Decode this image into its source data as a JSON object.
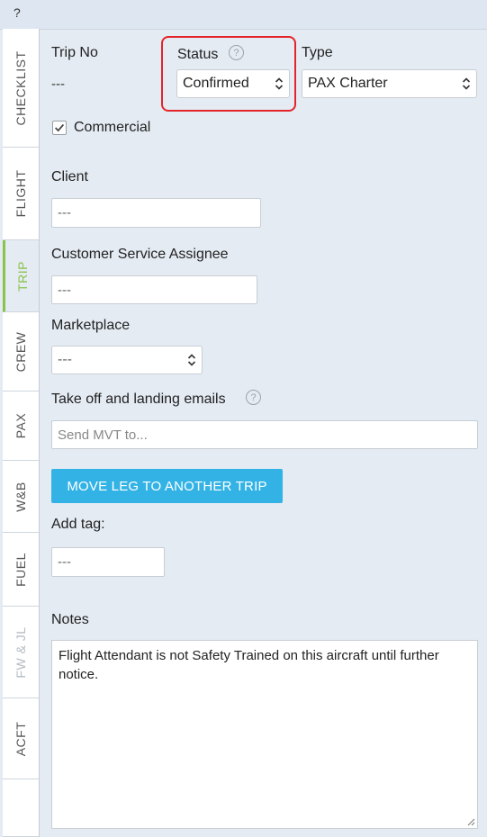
{
  "topbar": {
    "help": "?"
  },
  "side_tabs": [
    {
      "label": "CHECKLIST",
      "state": "normal"
    },
    {
      "label": "FLIGHT",
      "state": "normal"
    },
    {
      "label": "TRIP",
      "state": "active"
    },
    {
      "label": "CREW",
      "state": "normal"
    },
    {
      "label": "PAX",
      "state": "normal"
    },
    {
      "label": "W&B",
      "state": "normal"
    },
    {
      "label": "FUEL",
      "state": "normal"
    },
    {
      "label": "FW & JL",
      "state": "disabled"
    },
    {
      "label": "ACFT",
      "state": "normal"
    }
  ],
  "trip_no": {
    "label": "Trip No",
    "value": "---"
  },
  "status": {
    "label": "Status",
    "value": "Confirmed",
    "help": "?"
  },
  "type": {
    "label": "Type",
    "value": "PAX Charter"
  },
  "commercial": {
    "label": "Commercial",
    "checked": true
  },
  "client": {
    "label": "Client",
    "value": "---"
  },
  "cs_assignee": {
    "label": "Customer Service Assignee",
    "value": "---"
  },
  "marketplace": {
    "label": "Marketplace",
    "value": "---"
  },
  "emails": {
    "label": "Take off and landing emails",
    "placeholder": "Send MVT to...",
    "help": "?"
  },
  "move_button": {
    "label": "MOVE LEG TO ANOTHER TRIP"
  },
  "add_tag": {
    "label": "Add tag:",
    "value": "---"
  },
  "notes": {
    "label": "Notes",
    "value": "Flight Attendant is not Safety Trained on this aircraft until further notice."
  },
  "colors": {
    "accent_active": "#8bc34a",
    "button": "#33b3e5",
    "highlight": "#e3252b"
  }
}
